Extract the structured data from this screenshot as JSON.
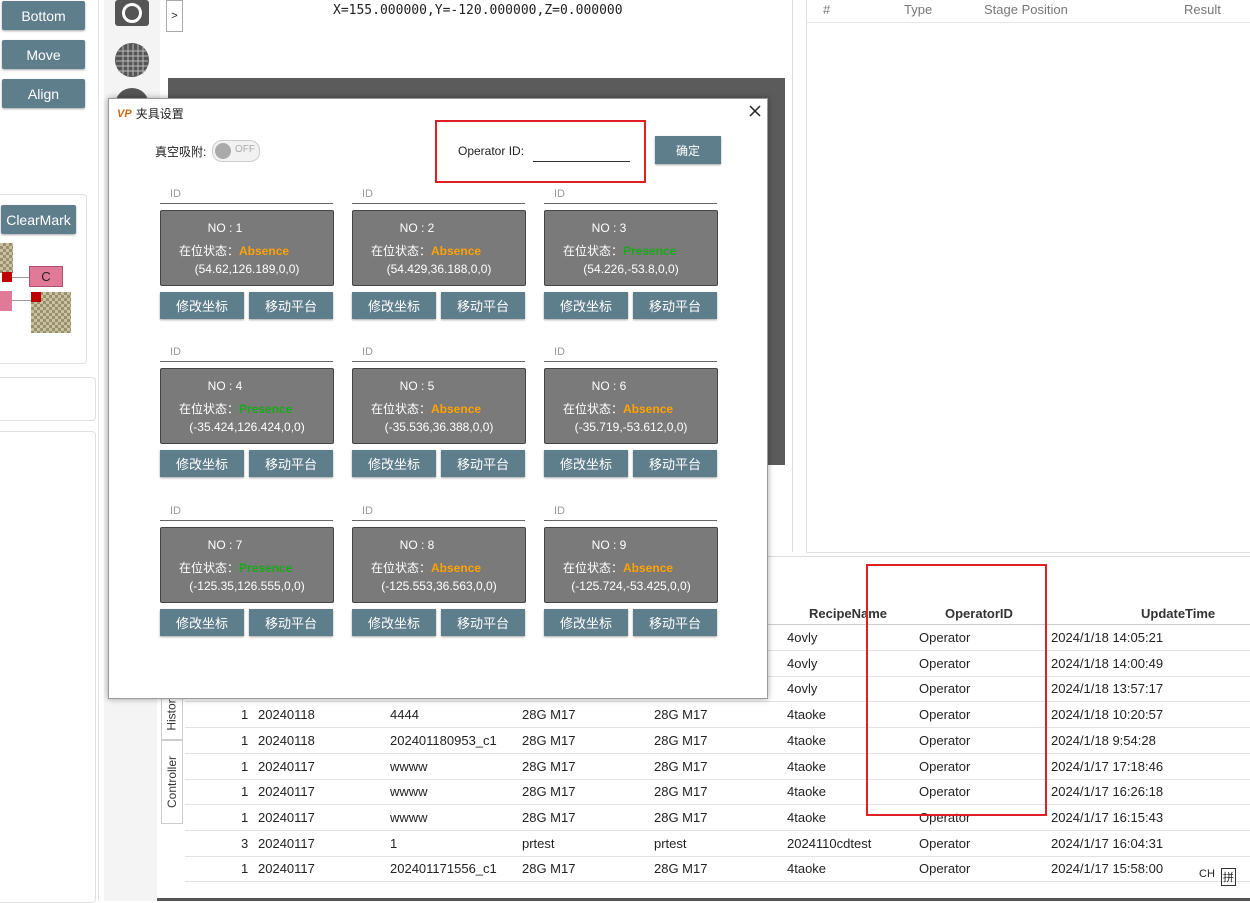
{
  "left_buttons": [
    "Bottom",
    "Move",
    "Align"
  ],
  "clearmark_label": "ClearMark",
  "mini_map": {
    "c_label": "C"
  },
  "expand_arrow": ">",
  "coord_readout": "X=155.000000,Y=-120.000000,Z=0.000000",
  "right_table_headers": [
    "#",
    "Type",
    "Stage Position",
    "Result"
  ],
  "bottom_table": {
    "headers": {
      "recipe": "RecipeName",
      "operator": "OperatorID",
      "time": "UpdateTime"
    },
    "rows": [
      {
        "c1": "",
        "c2": "",
        "c3": "",
        "c4": "",
        "c5": "",
        "recipe": "4ovly",
        "operator": "Operator",
        "time": "2024/1/18 14:05:21"
      },
      {
        "c1": "",
        "c2": "",
        "c3": "",
        "c4": "",
        "c5": "",
        "recipe": "4ovly",
        "operator": "Operator",
        "time": "2024/1/18 14:00:49"
      },
      {
        "c1": "",
        "c2": "",
        "c3": "",
        "c4": "",
        "c5": "",
        "recipe": "4ovly",
        "operator": "Operator",
        "time": "2024/1/18 13:57:17"
      },
      {
        "c1": "1",
        "c2": "20240118",
        "c3": "4444",
        "c4": "28G M17",
        "c5": "28G M17",
        "recipe": "4taoke",
        "operator": "Operator",
        "time": "2024/1/18 10:20:57"
      },
      {
        "c1": "1",
        "c2": "20240118",
        "c3": "202401180953_c1",
        "c4": "28G M17",
        "c5": "28G M17",
        "recipe": "4taoke",
        "operator": "Operator",
        "time": "2024/1/18 9:54:28"
      },
      {
        "c1": "1",
        "c2": "20240117",
        "c3": "wwww",
        "c4": "28G M17",
        "c5": "28G M17",
        "recipe": "4taoke",
        "operator": "Operator",
        "time": "2024/1/17 17:18:46"
      },
      {
        "c1": "1",
        "c2": "20240117",
        "c3": "wwww",
        "c4": "28G M17",
        "c5": "28G M17",
        "recipe": "4taoke",
        "operator": "Operator",
        "time": "2024/1/17 16:26:18"
      },
      {
        "c1": "1",
        "c2": "20240117",
        "c3": "wwww",
        "c4": "28G M17",
        "c5": "28G M17",
        "recipe": "4taoke",
        "operator": "Operator",
        "time": "2024/1/17 16:15:43"
      },
      {
        "c1": "3",
        "c2": "20240117",
        "c3": "1",
        "c4": "prtest",
        "c5": "prtest",
        "recipe": "2024110cdtest",
        "operator": "Operator",
        "time": "2024/1/17 16:04:31"
      },
      {
        "c1": "1",
        "c2": "20240117",
        "c3": "202401171556_c1",
        "c4": "28G M17",
        "c5": "28G M17",
        "recipe": "4taoke",
        "operator": "Operator",
        "time": "2024/1/17 15:58:00"
      }
    ]
  },
  "side_tabs": [
    "History",
    "Controller"
  ],
  "ime_indicator": {
    "lang": "CH",
    "mode": "拼"
  },
  "dialog": {
    "title": "夹具设置",
    "logo": "VP",
    "vacuum_label": "真空吸附:",
    "vacuum_state": "OFF",
    "operator_label": "Operator ID:",
    "operator_value": "",
    "confirm_label": "确定",
    "id_label": "ID",
    "status_label": "在位状态：",
    "edit_label": "修改坐标",
    "move_label": "移动平台",
    "fixtures": [
      {
        "no": "NO : 1",
        "status": "Absence",
        "coord": "(54.62,126.189,0,0)"
      },
      {
        "no": "NO : 2",
        "status": "Absence",
        "coord": "(54.429,36.188,0,0)"
      },
      {
        "no": "NO : 3",
        "status": "Presence",
        "coord": "(54.226,-53.8,0,0)"
      },
      {
        "no": "NO : 4",
        "status": "Presence",
        "coord": "(-35.424,126.424,0,0)"
      },
      {
        "no": "NO : 5",
        "status": "Absence",
        "coord": "(-35.536,36.388,0,0)"
      },
      {
        "no": "NO : 6",
        "status": "Absence",
        "coord": "(-35.719,-53.612,0,0)"
      },
      {
        "no": "NO : 7",
        "status": "Presence",
        "coord": "(-125.35,126.555,0,0)"
      },
      {
        "no": "NO : 8",
        "status": "Absence",
        "coord": "(-125.553,36.563,0,0)"
      },
      {
        "no": "NO : 9",
        "status": "Absence",
        "coord": "(-125.724,-53.425,0,0)"
      }
    ]
  },
  "colors": {
    "absence": "#ffa200",
    "presence": "#1aa81a",
    "button": "#5f7e8c",
    "highlight": "#e02020"
  }
}
